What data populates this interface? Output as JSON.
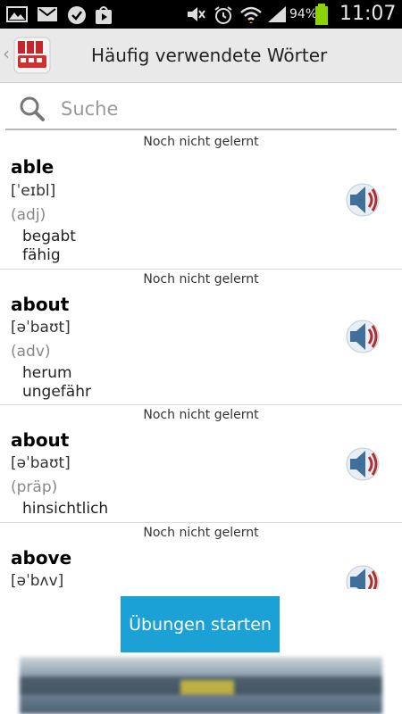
{
  "status_bar": {
    "battery_percent": "94%",
    "time": "11:07"
  },
  "header": {
    "title": "Häufig verwendete Wörter"
  },
  "search": {
    "placeholder": "Suche"
  },
  "entries": [
    {
      "status": "Noch nicht gelernt",
      "word": "able",
      "phonetic": "[ˈeɪbl]",
      "pos": "(adj)",
      "translations": [
        "begabt",
        "fähig"
      ]
    },
    {
      "status": "Noch nicht gelernt",
      "word": "about",
      "phonetic": "[əˈbaʊt]",
      "pos": "(adv)",
      "translations": [
        "herum",
        "ungefähr"
      ]
    },
    {
      "status": "Noch nicht gelernt",
      "word": "about",
      "phonetic": "[əˈbaʊt]",
      "pos": "(präp)",
      "translations": [
        "hinsichtlich"
      ]
    },
    {
      "status": "Noch nicht gelernt",
      "word": "above",
      "phonetic": "[əˈbʌv]",
      "pos": "",
      "translations": []
    }
  ],
  "footer": {
    "start_button": "Übungen starten"
  },
  "colors": {
    "accent": "#1ba1d6",
    "status_bar": "#000000",
    "action_bar": "#e9e9e9"
  }
}
